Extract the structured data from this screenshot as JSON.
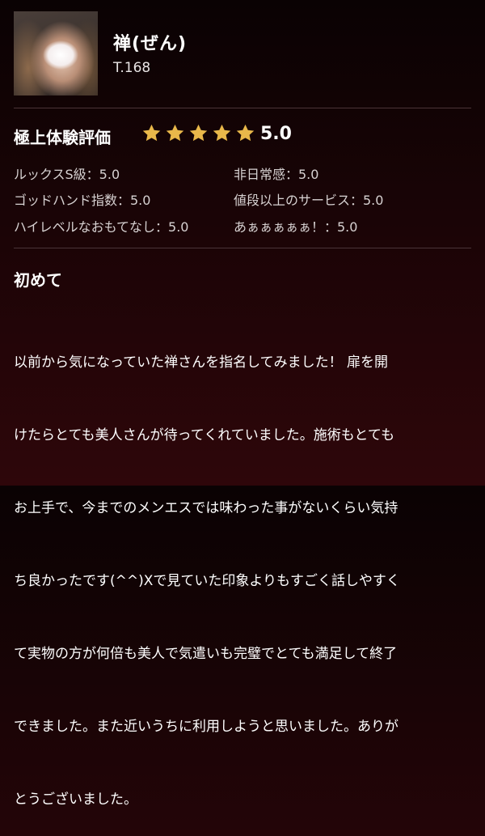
{
  "profile": {
    "name": "禅(ぜん)",
    "height": "T.168"
  },
  "rating": {
    "title": "極上体験評価",
    "stars": 5,
    "score": "5.0",
    "star_color": "#e9b84a",
    "items": [
      {
        "label": "ルックスS級：5.0"
      },
      {
        "label": "非日常感：5.0"
      },
      {
        "label": "ゴッドハンド指数：5.0"
      },
      {
        "label": "値段以上のサービス：5.0"
      },
      {
        "label": "ハイレベルなおもてなし：5.0"
      },
      {
        "label": "あぁぁぁぁぁ！：5.0"
      }
    ]
  },
  "review": {
    "title": "初めて",
    "lines": [
      "以前から気になっていた禅さんを指名してみました！ 扉を開",
      "けたらとても美人さんが待ってくれていました。施術もとても",
      "お上手で、今までのメンエスでは味わった事がないくらい気持",
      "ち良かったです(^^)Xで見ていた印象よりもすごく話しやすく",
      "て実物の方が何倍も美人で気遣いも完璧でとても満足して終了",
      "できました。また近いうちに利用しようと思いました。ありが",
      "とうございました。"
    ]
  }
}
